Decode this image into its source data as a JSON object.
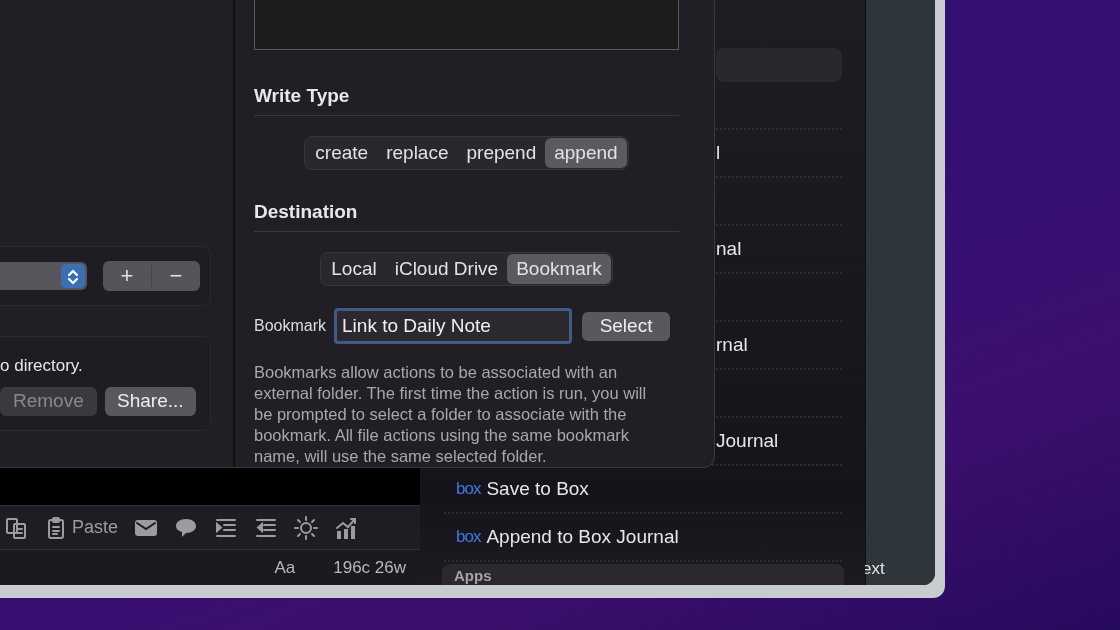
{
  "back_window": {
    "sidebar_label": "ext"
  },
  "actions": {
    "items": [
      {
        "kind": "partial",
        "label": "l"
      },
      {
        "kind": "partial",
        "label": "nal"
      },
      {
        "kind": "partial",
        "label": "rnal"
      },
      {
        "kind": "partial",
        "label": "Journal"
      },
      {
        "kind": "action",
        "badge": "box",
        "label": "Save to Box"
      },
      {
        "kind": "action",
        "badge": "box",
        "label": "Append to Box Journal"
      }
    ],
    "section": "Apps"
  },
  "dialog": {
    "left": {
      "add": "+",
      "remove": "−",
      "note": "o directory.",
      "buttons": [
        {
          "label": "Remove",
          "disabled": true
        },
        {
          "label": "Share...",
          "disabled": false
        }
      ]
    },
    "write_type": {
      "title": "Write Type",
      "options": [
        {
          "label": "create",
          "selected": false
        },
        {
          "label": "replace",
          "selected": false
        },
        {
          "label": "prepend",
          "selected": false
        },
        {
          "label": "append",
          "selected": true
        }
      ]
    },
    "destination": {
      "title": "Destination",
      "options": [
        {
          "label": "Local",
          "selected": false
        },
        {
          "label": "iCloud Drive",
          "selected": false
        },
        {
          "label": "Bookmark",
          "selected": true
        }
      ]
    },
    "bookmark": {
      "label": "Bookmark",
      "value": "Link to Daily Note",
      "button": "Select"
    },
    "help": "Bookmarks allow actions to be associated with an external folder. The first time the action is run, you will be prompted to select a folder to associate with the bookmark. All file actions using the same bookmark name, will use the same selected folder."
  },
  "editor": {
    "toolbar": [
      {
        "kind": "copy"
      },
      {
        "kind": "paste",
        "label": "Paste"
      },
      {
        "kind": "mail"
      },
      {
        "kind": "comment"
      },
      {
        "kind": "indent"
      },
      {
        "kind": "outdent"
      },
      {
        "kind": "sun"
      },
      {
        "kind": "chart"
      }
    ],
    "status": [
      "Aa",
      "196c 26w"
    ]
  }
}
